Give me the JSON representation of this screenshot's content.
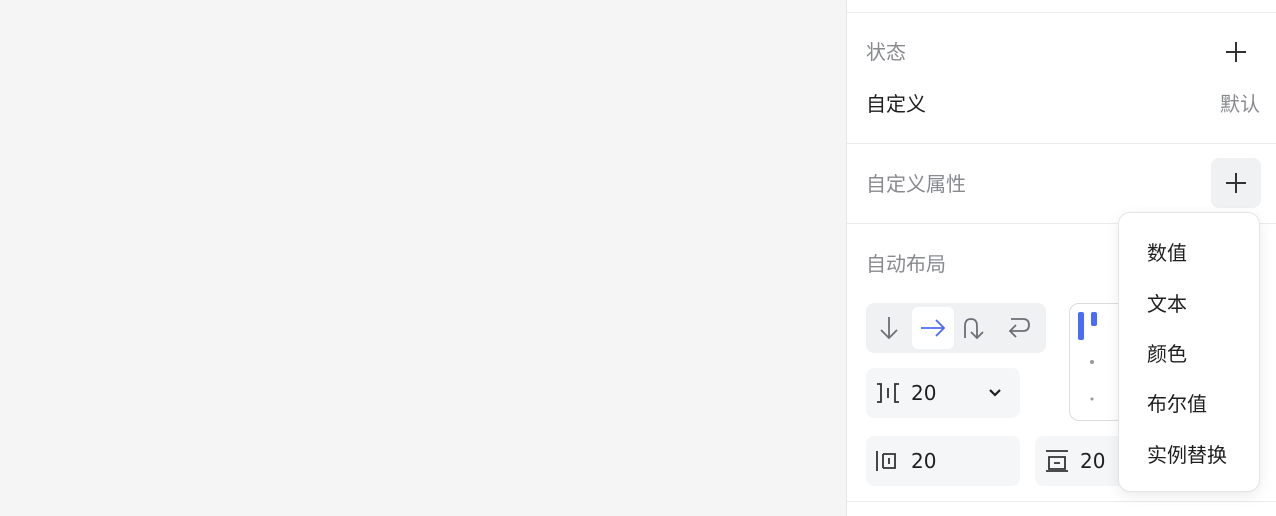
{
  "panel": {
    "state": {
      "title": "状态",
      "row_label": "自定义",
      "row_value": "默认"
    },
    "custom_props": {
      "title": "自定义属性"
    },
    "auto_layout": {
      "title": "自动布局",
      "direction_options": [
        "vertical",
        "horizontal",
        "wrap",
        "reverse"
      ],
      "selected_direction": "horizontal",
      "spacing_value": "20",
      "padding_horizontal_value": "20",
      "padding_vertical_value": "20"
    }
  },
  "dropdown_menu": {
    "items": [
      "数值",
      "文本",
      "颜色",
      "布尔值",
      "实例替换"
    ]
  },
  "colors": {
    "accent": "#4a6cf7",
    "muted_text": "#888a8f",
    "text": "#1f1f1f"
  }
}
